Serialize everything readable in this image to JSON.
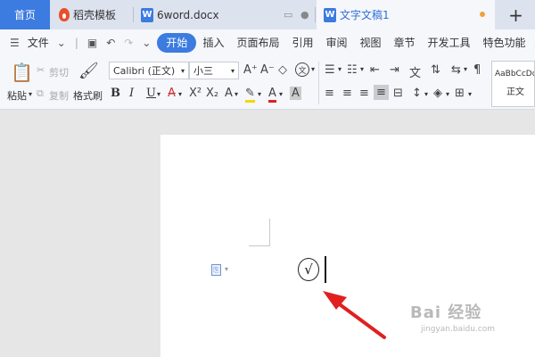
{
  "tabs": {
    "home": "首页",
    "template": "稻壳模板",
    "doc": "6word.docx",
    "active": "文字文稿1",
    "add": "+"
  },
  "menu": {
    "file": "文件",
    "items": [
      "开始",
      "插入",
      "页面布局",
      "引用",
      "审阅",
      "视图",
      "章节",
      "开发工具",
      "特色功能"
    ]
  },
  "ribbon": {
    "paste": "粘贴",
    "cut": "剪切",
    "copy": "复制",
    "format_painter": "格式刷",
    "font_name": "Calibri (正文)",
    "font_size": "小三",
    "style_preview": "AaBbCcDd",
    "style_name": "正文",
    "bold": "B",
    "italic": "I",
    "underline": "U"
  },
  "document": {
    "content_symbol": "√"
  },
  "watermark": {
    "logo": "Bai 经验",
    "sub": "jingyan.baidu.com"
  },
  "colors": {
    "accent": "#3c7be0",
    "arrow": "#e02020"
  }
}
